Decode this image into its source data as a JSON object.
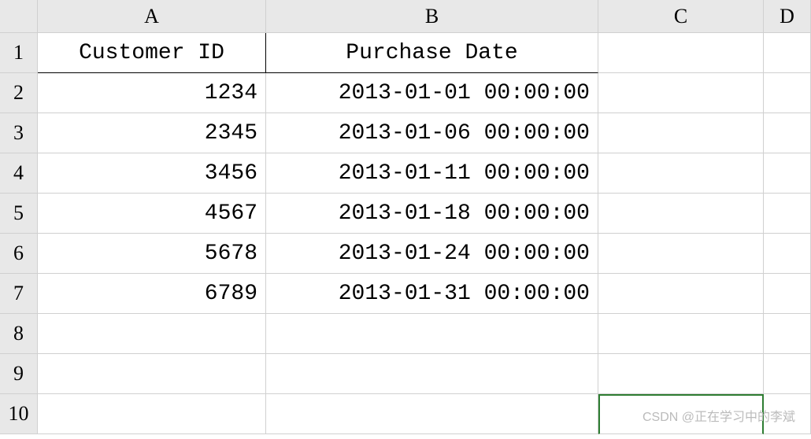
{
  "columns": [
    "A",
    "B",
    "C",
    "D"
  ],
  "row_numbers": [
    "1",
    "2",
    "3",
    "4",
    "5",
    "6",
    "7",
    "8",
    "9",
    "10"
  ],
  "headers": {
    "a": "Customer ID",
    "b": "Purchase Date"
  },
  "rows": [
    {
      "id": "1234",
      "date": "2013-01-01 00:00:00"
    },
    {
      "id": "2345",
      "date": "2013-01-06 00:00:00"
    },
    {
      "id": "3456",
      "date": "2013-01-11 00:00:00"
    },
    {
      "id": "4567",
      "date": "2013-01-18 00:00:00"
    },
    {
      "id": "5678",
      "date": "2013-01-24 00:00:00"
    },
    {
      "id": "6789",
      "date": "2013-01-31 00:00:00"
    }
  ],
  "watermark": "CSDN @正在学习中的李斌",
  "chart_data": {
    "type": "table",
    "title": "",
    "columns": [
      "Customer ID",
      "Purchase Date"
    ],
    "rows": [
      [
        "1234",
        "2013-01-01 00:00:00"
      ],
      [
        "2345",
        "2013-01-06 00:00:00"
      ],
      [
        "3456",
        "2013-01-11 00:00:00"
      ],
      [
        "4567",
        "2013-01-18 00:00:00"
      ],
      [
        "5678",
        "2013-01-24 00:00:00"
      ],
      [
        "6789",
        "2013-01-31 00:00:00"
      ]
    ]
  }
}
